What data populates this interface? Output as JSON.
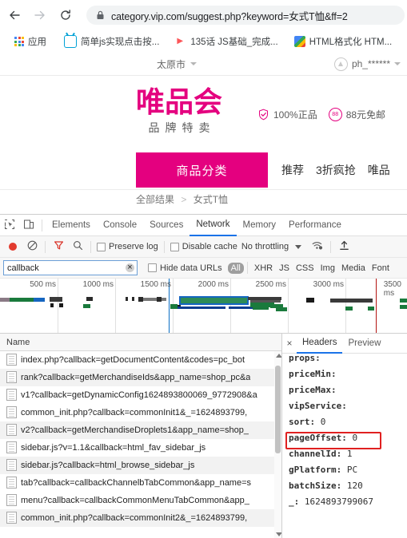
{
  "browser": {
    "back_icon": "back-arrow-icon",
    "forward_icon": "forward-arrow-icon",
    "reload_icon": "reload-icon",
    "lock_icon": "lock-icon",
    "url": "category.vip.com/suggest.php?keyword=女式T恤&ff=2",
    "bookmarks": [
      {
        "label": "应用",
        "icon": "apps-grid-icon"
      },
      {
        "label": "简单js实现点击按...",
        "icon": "bilibili-favicon"
      },
      {
        "label": "135话 JS基础_完成...",
        "icon": "video-favicon"
      },
      {
        "label": "HTML格式化 HTM...",
        "icon": "html-favicon"
      }
    ]
  },
  "site": {
    "city": "太原市",
    "user": "ph_******",
    "logo_main": "唯品会",
    "logo_sub": "品牌特卖",
    "badges": [
      {
        "icon": "shield-check-icon",
        "label": "100%正品"
      },
      {
        "icon": "badge-88-icon",
        "label": "88元免邮"
      }
    ],
    "nav_category": "商品分类",
    "nav_links": [
      "推荐",
      "3折疯抢",
      "唯品"
    ],
    "breadcrumb": [
      "全部结果",
      "女式T恤"
    ]
  },
  "devtools": {
    "inspect_icon": "inspect-element-icon",
    "device_icon": "device-toolbar-icon",
    "tabs": [
      {
        "label": "Elements",
        "active": false
      },
      {
        "label": "Console",
        "active": false
      },
      {
        "label": "Sources",
        "active": false
      },
      {
        "label": "Network",
        "active": true
      },
      {
        "label": "Memory",
        "active": false
      },
      {
        "label": "Performance",
        "active": false
      }
    ],
    "toolbar": {
      "record_icon": "record-button-icon",
      "clear_icon": "clear-icon",
      "filter_icon": "filter-funnel-icon",
      "search_icon": "search-icon",
      "preserve_log": "Preserve log",
      "disable_cache": "Disable cache",
      "throttling": "No throttling",
      "throttle_caret": "chevron-down-icon",
      "wifi_icon": "wifi-settings-icon",
      "import_icon": "import-har-icon"
    },
    "filter": {
      "value": "callback",
      "clear_icon": "clear-input-icon",
      "hide_data_urls": "Hide data URLs",
      "types": [
        "All",
        "XHR",
        "JS",
        "CSS",
        "Img",
        "Media",
        "Font"
      ],
      "selected_type": "All"
    },
    "timeline": {
      "ticks": [
        "500 ms",
        "1000 ms",
        "1500 ms",
        "2000 ms",
        "2500 ms",
        "3000 ms",
        "3500 ms"
      ],
      "dom_content_loaded_color": "#0b6fc4",
      "load_color": "#b31412"
    },
    "list": {
      "column_name": "Name",
      "rows": [
        "index.php?callback=getDocumentContent&codes=pc_bot",
        "rank?callback=getMerchandiseIds&app_name=shop_pc&a",
        "v1?callback=getDynamicConfig1624893800069_9772908&a",
        "common_init.php?callback=commonInit1&_=1624893799,",
        "v2?callback=getMerchandiseDroplets1&app_name=shop_",
        "sidebar.js?v=1.1&callback=html_fav_sidebar_js",
        "sidebar.js?callback=html_browse_sidebar_js",
        "tab?callback=callbackChannelbTabCommon&app_name=s",
        "menu?callback=callbackCommonMenuTabCommon&app_",
        "common_init.php?callback=commonInit2&_=1624893799,"
      ]
    },
    "detail": {
      "close_icon": "close-icon",
      "tabs": [
        {
          "label": "Headers",
          "active": true
        },
        {
          "label": "Preview",
          "active": false
        }
      ],
      "params": [
        {
          "key": "props:",
          "value": ""
        },
        {
          "key": "priceMin:",
          "value": ""
        },
        {
          "key": "priceMax:",
          "value": ""
        },
        {
          "key": "vipService:",
          "value": ""
        },
        {
          "key": "sort:",
          "value": "0"
        },
        {
          "key": "pageOffset:",
          "value": "0"
        },
        {
          "key": "channelId:",
          "value": "1"
        },
        {
          "key": "gPlatform:",
          "value": "PC"
        },
        {
          "key": "batchSize:",
          "value": "120"
        },
        {
          "key": "_:",
          "value": "1624893799067"
        }
      ],
      "highlight_key": "pageOffset:",
      "highlight_color": "#e02020"
    }
  }
}
